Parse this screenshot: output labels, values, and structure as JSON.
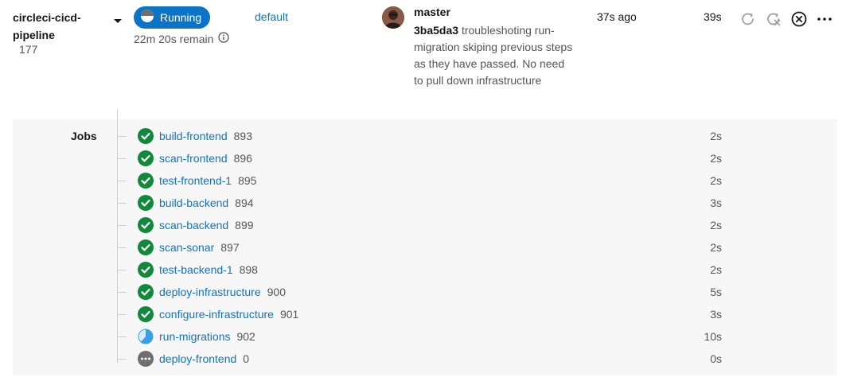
{
  "pipeline": {
    "project_name": "circleci-cicd-pipeline",
    "pipeline_number": "177",
    "status_label": "Running",
    "remaining": "22m 20s remain",
    "branch_link": "default",
    "commit": {
      "branch": "master",
      "hash": "3ba5da3",
      "message": "troubleshoting run-migration skiping previous steps as they have passed. No need to pull down infrastructure"
    },
    "time_ago": "37s ago",
    "duration": "39s",
    "actions": [
      "rerun-icon",
      "rerun-from-failed-icon",
      "cancel-icon",
      "more-icon"
    ]
  },
  "jobs": {
    "label": "Jobs",
    "items": [
      {
        "name": "build-frontend",
        "number": "893",
        "duration": "2s",
        "status": "success"
      },
      {
        "name": "scan-frontend",
        "number": "896",
        "duration": "2s",
        "status": "success"
      },
      {
        "name": "test-frontend-1",
        "number": "895",
        "duration": "2s",
        "status": "success"
      },
      {
        "name": "build-backend",
        "number": "894",
        "duration": "3s",
        "status": "success"
      },
      {
        "name": "scan-backend",
        "number": "899",
        "duration": "2s",
        "status": "success"
      },
      {
        "name": "scan-sonar",
        "number": "897",
        "duration": "2s",
        "status": "success"
      },
      {
        "name": "test-backend-1",
        "number": "898",
        "duration": "2s",
        "status": "success"
      },
      {
        "name": "deploy-infrastructure",
        "number": "900",
        "duration": "5s",
        "status": "success"
      },
      {
        "name": "configure-infrastructure",
        "number": "901",
        "duration": "3s",
        "status": "success"
      },
      {
        "name": "run-migrations",
        "number": "902",
        "duration": "10s",
        "status": "running"
      },
      {
        "name": "deploy-frontend",
        "number": "0",
        "duration": "0s",
        "status": "blocked"
      }
    ]
  },
  "colors": {
    "accent": "#0b74c9",
    "success": "#0f8a3a",
    "running": "#3aa0e6",
    "blocked": "#6f6f6f"
  }
}
